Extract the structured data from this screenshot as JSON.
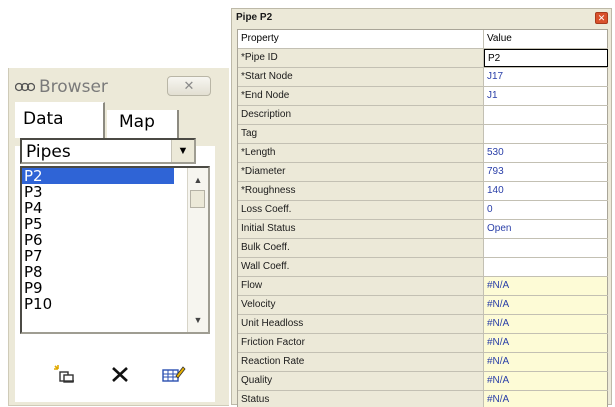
{
  "browser": {
    "title": "Browser",
    "close_glyph": "✕",
    "tabs": [
      {
        "label": "Data"
      },
      {
        "label": "Map"
      }
    ],
    "category_select": {
      "selected": "Pipes",
      "arrow_glyph": "▼"
    },
    "items": [
      "P2",
      "P3",
      "P4",
      "P5",
      "P6",
      "P7",
      "P8",
      "P9",
      "P10"
    ],
    "selected_item": "P2",
    "scroll_up_glyph": "▲",
    "scroll_down_glyph": "▼",
    "toolbar": {
      "add_icon": "add-object-icon",
      "delete_icon": "delete-x-icon",
      "edit_icon": "edit-object-icon"
    }
  },
  "editor": {
    "title": "Pipe P2",
    "close_glyph": "✕",
    "header": {
      "property": "Property",
      "value": "Value"
    },
    "rows": [
      {
        "property": "*Pipe ID",
        "value": "P2"
      },
      {
        "property": "*Start Node",
        "value": "J17"
      },
      {
        "property": "*End Node",
        "value": "J1"
      },
      {
        "property": "Description",
        "value": ""
      },
      {
        "property": "Tag",
        "value": ""
      },
      {
        "property": "*Length",
        "value": "530"
      },
      {
        "property": "*Diameter",
        "value": "793"
      },
      {
        "property": "*Roughness",
        "value": "140"
      },
      {
        "property": "Loss Coeff.",
        "value": "0"
      },
      {
        "property": "Initial Status",
        "value": "Open"
      },
      {
        "property": "Bulk Coeff.",
        "value": ""
      },
      {
        "property": "Wall Coeff.",
        "value": ""
      },
      {
        "property": "Flow",
        "value": "#N/A"
      },
      {
        "property": "Velocity",
        "value": "#N/A"
      },
      {
        "property": "Unit Headloss",
        "value": "#N/A"
      },
      {
        "property": "Friction Factor",
        "value": "#N/A"
      },
      {
        "property": "Reaction Rate",
        "value": "#N/A"
      },
      {
        "property": "Quality",
        "value": "#N/A"
      },
      {
        "property": "Status",
        "value": "#N/A"
      }
    ]
  },
  "colors": {
    "panel_bg": "#ece9d8",
    "selection": "#2f64d6",
    "value_text": "#2a3fa8",
    "readonly_bg": "#fdfbd6",
    "close_button": "#d9512c"
  }
}
